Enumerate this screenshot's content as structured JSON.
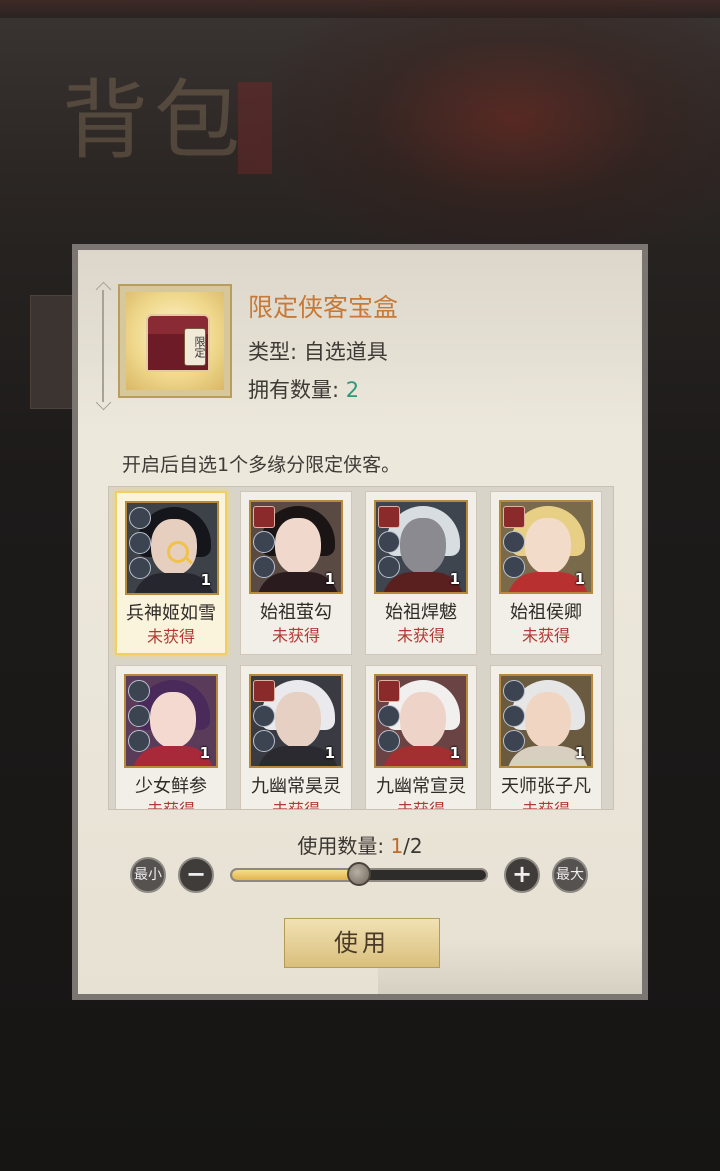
{
  "background": {
    "title": "背包"
  },
  "item": {
    "name": "限定侠客宝盒",
    "chest_tag": "限定",
    "type_label": "类型: ",
    "type_value": "自选道具",
    "count_label": "拥有数量: ",
    "count_value": "2"
  },
  "description": "开启后自选1个多缘分限定侠客。",
  "heroes": [
    {
      "name": "兵神姬如雪",
      "status": "未获得",
      "qty": "1"
    },
    {
      "name": "始祖萤勾",
      "status": "未获得",
      "qty": "1"
    },
    {
      "name": "始祖焊魃",
      "status": "未获得",
      "qty": "1"
    },
    {
      "name": "始祖侯卿",
      "status": "未获得",
      "qty": "1"
    },
    {
      "name": "少女鲜参",
      "status": "未获得",
      "qty": "1"
    },
    {
      "name": "九幽常昊灵",
      "status": "未获得",
      "qty": "1"
    },
    {
      "name": "九幽常宣灵",
      "status": "未获得",
      "qty": "1"
    },
    {
      "name": "天师张子凡",
      "status": "未获得",
      "qty": "1"
    }
  ],
  "selected_index": 0,
  "use_count": {
    "label": "使用数量: ",
    "current": "1",
    "separator": "/",
    "max": "2",
    "fraction": 0.5
  },
  "controls": {
    "min_label": "最小",
    "minus_label": "−",
    "plus_label": "+",
    "max_label": "最大"
  },
  "use_button": "使用",
  "colors": {
    "accent_orange": "#c77a38",
    "count_green": "#2a9a7a",
    "status_red": "#b23a34",
    "slider_gold": "#e1b44e",
    "selected_glow": "#f2cf61"
  }
}
